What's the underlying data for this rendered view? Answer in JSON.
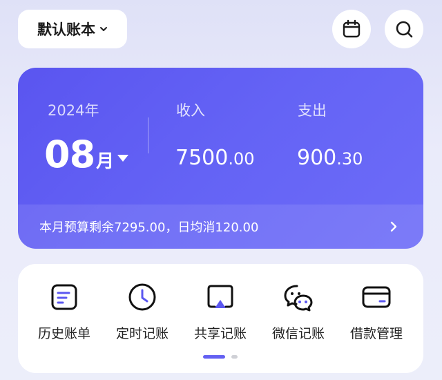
{
  "header": {
    "book_name": "默认账本",
    "calendar_icon": "calendar-icon",
    "search_icon": "search-icon"
  },
  "summary": {
    "year": "2024年",
    "month": "08",
    "month_unit": "月",
    "income_label": "收入",
    "income_int": "7500",
    "income_dec": ".00",
    "expense_label": "支出",
    "expense_int": "900",
    "expense_dec": ".30",
    "budget_text": "本月预算剩余7295.00，日均消120.00"
  },
  "shortcuts": [
    {
      "label": "历史账单",
      "icon": "bill-history-icon"
    },
    {
      "label": "定时记账",
      "icon": "clock-icon"
    },
    {
      "label": "共享记账",
      "icon": "share-screen-icon"
    },
    {
      "label": "微信记账",
      "icon": "wechat-icon"
    },
    {
      "label": "借款管理",
      "icon": "card-icon"
    }
  ],
  "pager": {
    "pages": 2,
    "current": 1
  },
  "colors": {
    "accent": "#6360f2",
    "card_gradient_start": "#5a55f0",
    "card_gradient_end": "#6d6cf8"
  }
}
